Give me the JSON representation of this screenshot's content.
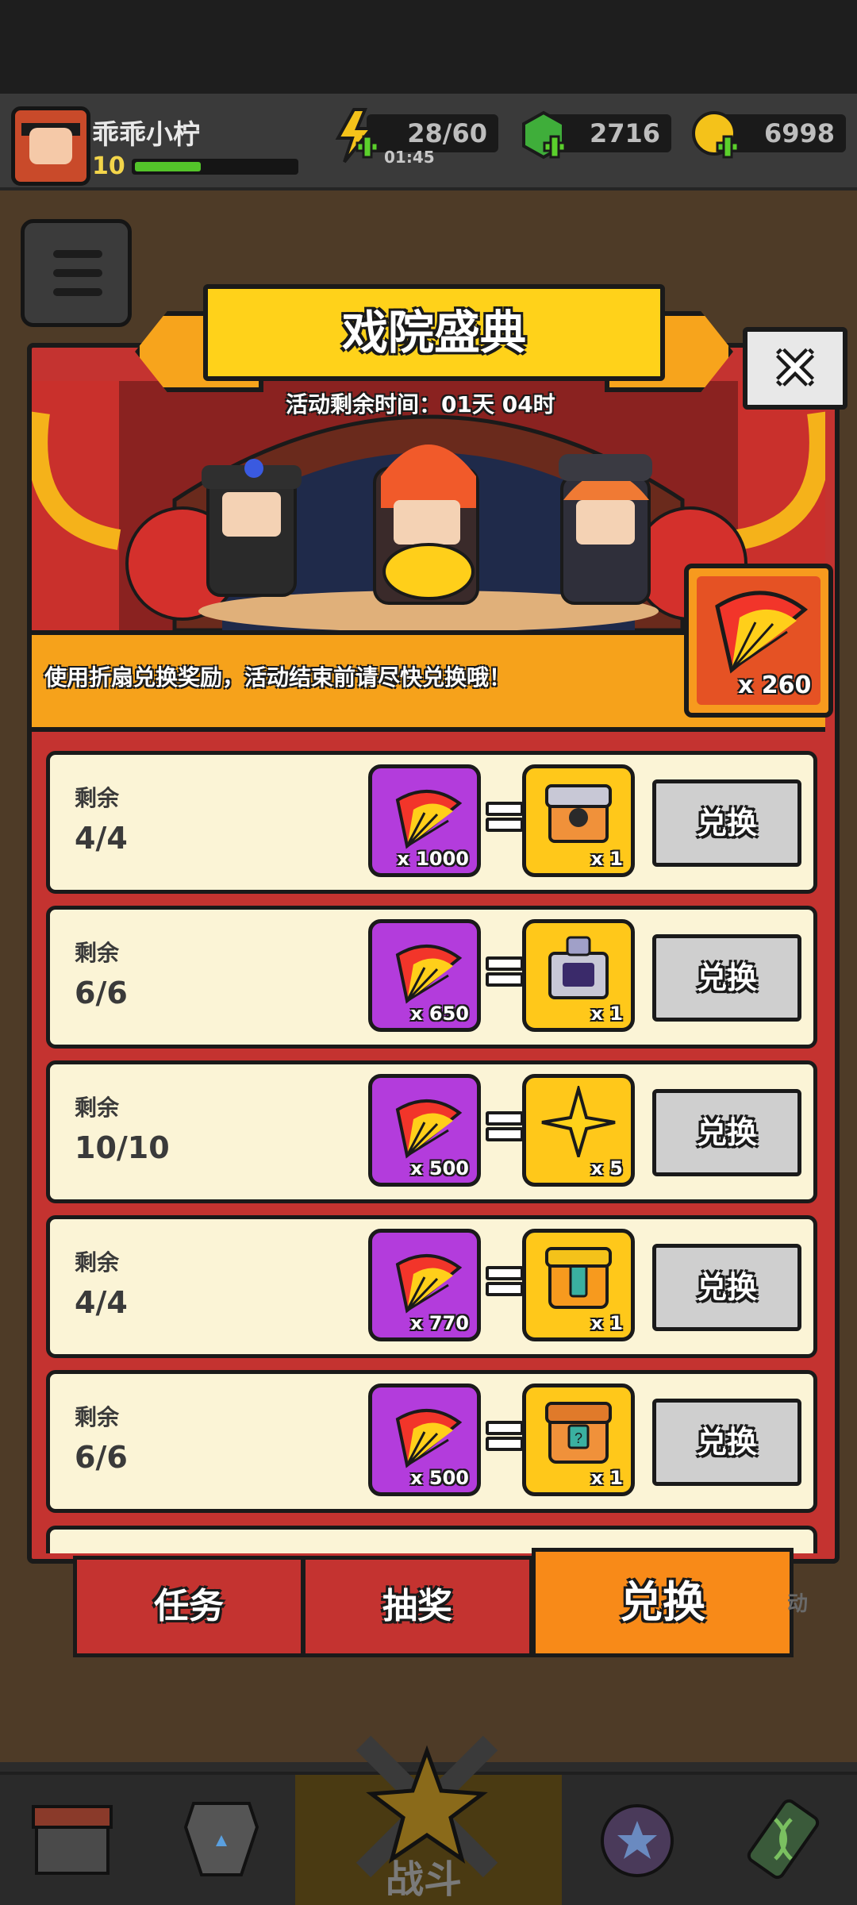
{
  "player": {
    "name": "乖乖小柠",
    "level": "10",
    "xp_fraction": 0.41
  },
  "resources": {
    "energy": "28/60",
    "energy_timer": "01:45",
    "gems": "2716",
    "coins": "6998"
  },
  "event": {
    "title": "戏院盛典",
    "timer": "活动剩余时间：01天 04时",
    "notice": "使用折扇兑换奖励，活动结束前请尽快兑换哦！",
    "fan_count": "x 260"
  },
  "exchange": {
    "remaining_label": "剩余",
    "rows": [
      {
        "remaining": "4/4",
        "cost": "x 1000",
        "reward_icon": "silver-chest-icon",
        "reward_qty": "x 1",
        "button": "兑换"
      },
      {
        "remaining": "6/6",
        "cost": "x 650",
        "reward_icon": "purple-chest-icon",
        "reward_qty": "x 1",
        "button": "兑换"
      },
      {
        "remaining": "10/10",
        "cost": "x 500",
        "reward_icon": "star-shard-icon",
        "reward_qty": "x 5",
        "button": "兑换"
      },
      {
        "remaining": "4/4",
        "cost": "x 770",
        "reward_icon": "gold-chest-icon",
        "reward_qty": "x 1",
        "button": "兑换"
      },
      {
        "remaining": "6/6",
        "cost": "x 500",
        "reward_icon": "mystery-chest-icon",
        "reward_qty": "x 1",
        "button": "兑换"
      }
    ]
  },
  "tabs": {
    "task": "任务",
    "lottery": "抽奖",
    "exchange": "兑换",
    "side": "动"
  },
  "nav": {
    "battle": "战斗"
  },
  "colors": {
    "panel_red": "#c43330",
    "accent_orange": "#f88a18",
    "title_yellow": "#ffd21a",
    "cost_purple": "#b33cdc"
  }
}
